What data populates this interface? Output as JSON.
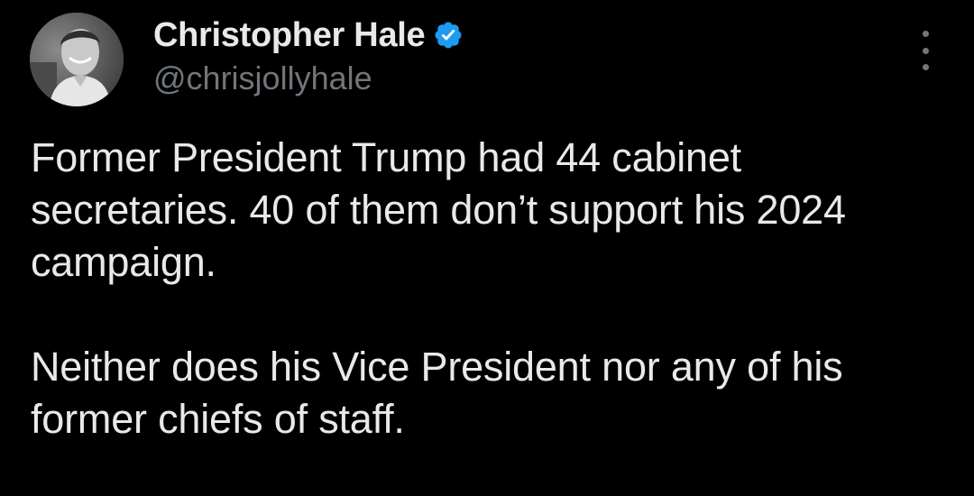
{
  "author": {
    "display_name": "Christopher Hale",
    "handle": "@chrisjollyhale",
    "verified": true,
    "avatar_icon": "profile-photo",
    "verified_icon": "verified-badge-icon"
  },
  "menu": {
    "icon": "more-vertical-icon"
  },
  "tweet": {
    "paragraphs": [
      "Former President Trump had 44 cabinet secretaries. 40 of them don’t support his 2024 campaign.",
      "Neither does his Vice President nor any of his former chiefs of staff."
    ]
  },
  "colors": {
    "background": "#000000",
    "primary_text": "#e7e9ea",
    "secondary_text": "#71767b",
    "verified_blue": "#1d9bf0"
  }
}
